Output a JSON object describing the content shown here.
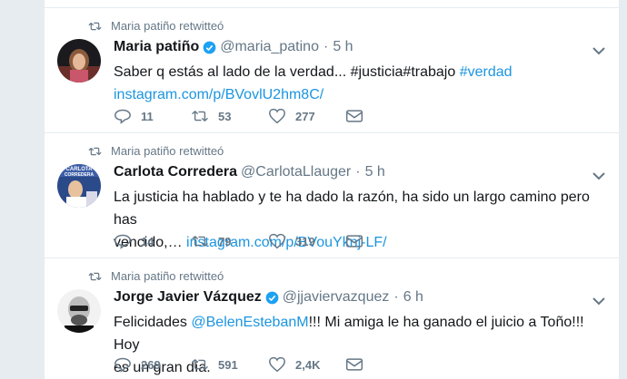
{
  "colors": {
    "link": "#1b95e0",
    "muted": "#657786",
    "verified": "#1da1f2",
    "divider": "#e6ecf0"
  },
  "tweets": [
    {
      "retweet_context": "Maria patiño retwitteó",
      "fullname": "Maria patiño",
      "verified": true,
      "username": "@maria_patino",
      "time": "5 h",
      "text_1": "Saber q estás al lado de la verdad... #justicia#trabajo ",
      "hashtag": "#verdad",
      "link": "instagram.com/p/BVovlU2hm8C/",
      "reply_count": "11",
      "retweet_count": "53",
      "like_count": "277"
    },
    {
      "retweet_context": "Maria patiño retwitteó",
      "fullname": "Carlota Corredera",
      "verified": false,
      "username": "@CarlotaLlauger",
      "time": "5 h",
      "text_1": "La justicia ha hablado y te ha dado la razón, ha sido un largo camino pero has",
      "text_2": "vencido,… ",
      "link": "instagram.com/p/BVouYknj-LF/",
      "avatar_text": "CARLOTA CORREDERA",
      "reply_count": "14",
      "retweet_count": "79",
      "like_count": "319"
    },
    {
      "retweet_context": "Maria patiño retwitteó",
      "fullname": "Jorge Javier Vázquez",
      "verified": true,
      "username": "@jjaviervazquez",
      "time": "6 h",
      "text_1": "Felicidades ",
      "mention": "@BelenEstebanM",
      "text_2": "!!! Mi amiga le ha ganado el juicio a Toño!!! Hoy",
      "text_3": "es un gran día.",
      "reply_count": "269",
      "retweet_count": "591",
      "like_count": "2,4K"
    }
  ]
}
